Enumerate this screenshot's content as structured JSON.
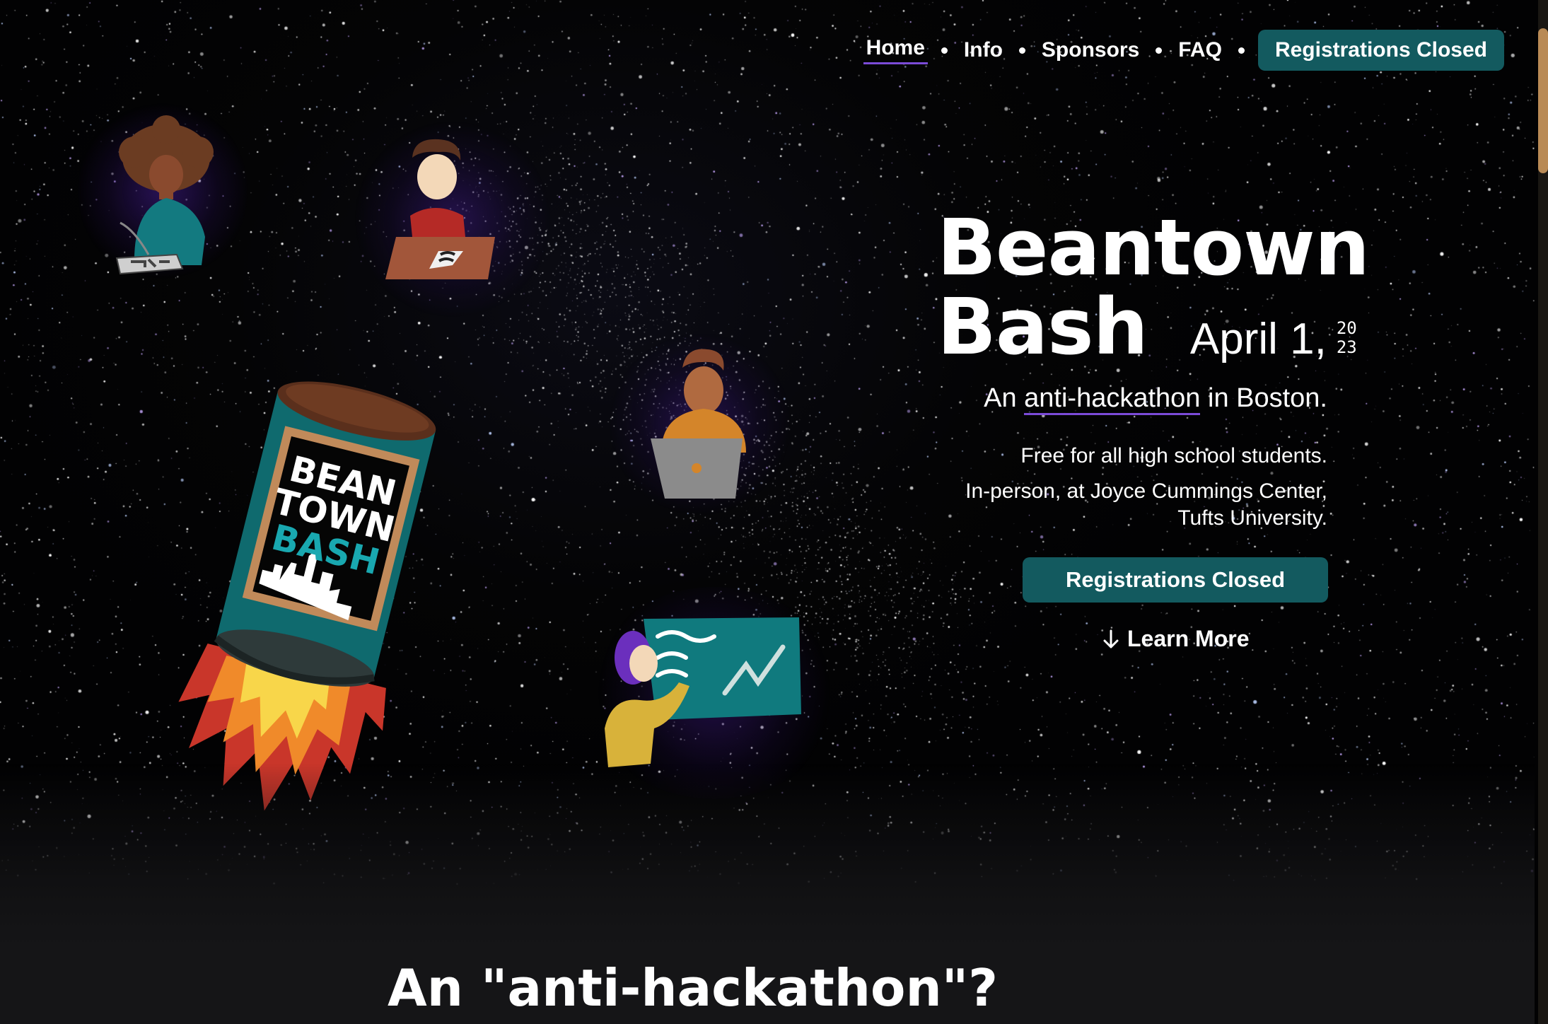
{
  "nav": {
    "items": [
      {
        "label": "Home",
        "active": true
      },
      {
        "label": "Info",
        "active": false
      },
      {
        "label": "Sponsors",
        "active": false
      },
      {
        "label": "FAQ",
        "active": false
      }
    ],
    "cta_label": "Registrations Closed"
  },
  "hero": {
    "title_line1": "Beantown",
    "title_line2": "Bash",
    "date": "April 1,",
    "year_top": "20",
    "year_bottom": "23",
    "tagline_prefix": "An ",
    "tagline_highlight": "anti-hackathon",
    "tagline_suffix": " in Boston.",
    "line1": "Free for all high school students.",
    "line2": "In-person, at Joyce Cummings Center, Tufts University.",
    "cta_label": "Registrations Closed",
    "learn_more": "Learn More"
  },
  "can_label": {
    "line1": "BEAN",
    "line2": "TOWN",
    "line3": "BASH"
  },
  "section": {
    "title": "An \"anti-hackathon\"?"
  },
  "colors": {
    "accent_teal": "#135a5f",
    "underline_purple": "#7b4bd8",
    "scrollbar_thumb": "#b98a55"
  },
  "icons": {
    "learn_more": "arrow-down-icon"
  }
}
